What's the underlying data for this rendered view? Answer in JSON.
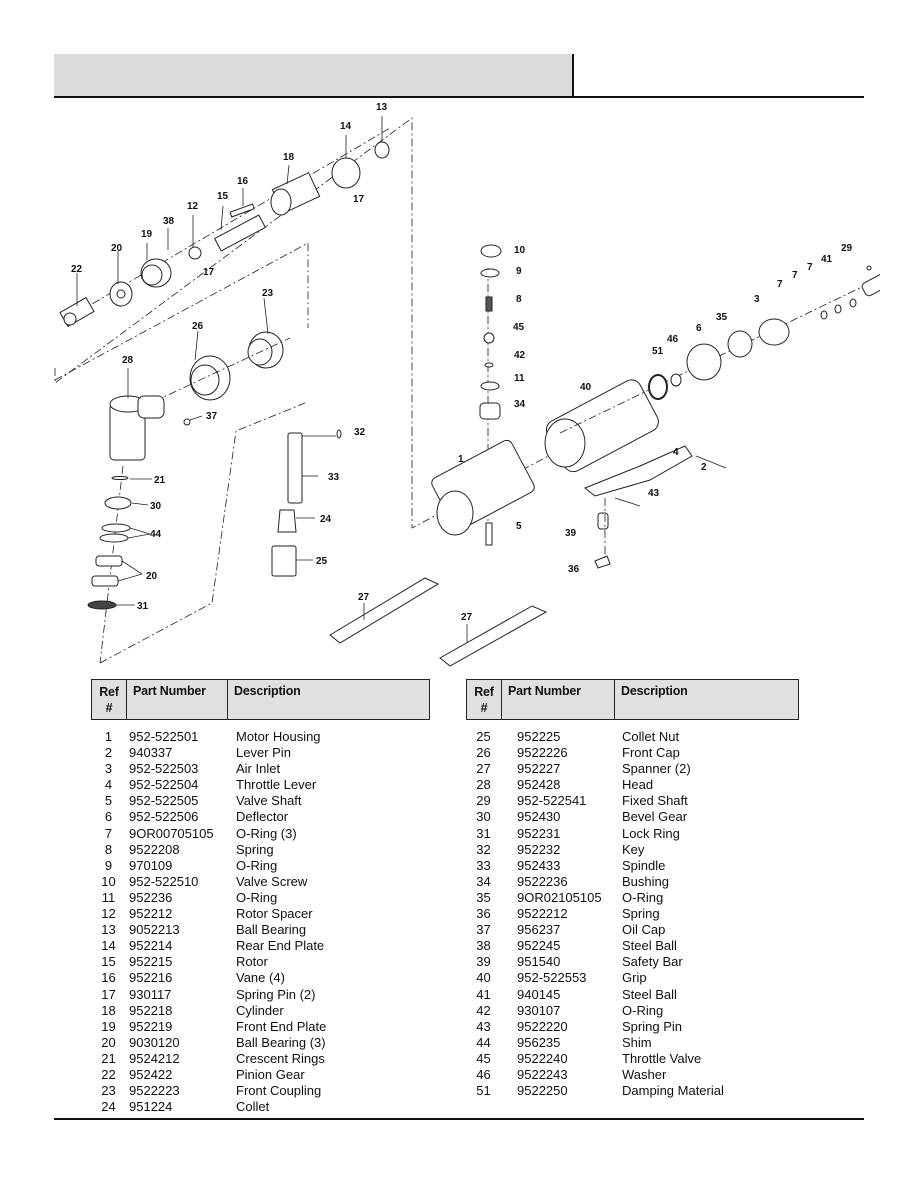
{
  "header": {
    "title": "",
    "section": ""
  },
  "diagram": {
    "labels": [
      "1",
      "2",
      "3",
      "4",
      "5",
      "6",
      "7",
      "7",
      "7",
      "8",
      "9",
      "10",
      "11",
      "12",
      "13",
      "14",
      "15",
      "16",
      "17",
      "17",
      "18",
      "19",
      "20",
      "20",
      "21",
      "22",
      "23",
      "24",
      "25",
      "26",
      "27",
      "27",
      "28",
      "29",
      "30",
      "31",
      "32",
      "33",
      "34",
      "35",
      "36",
      "37",
      "38",
      "39",
      "40",
      "41",
      "42",
      "43",
      "44",
      "45",
      "46",
      "51"
    ]
  },
  "parts_table": {
    "headers": {
      "ref": "Ref #",
      "ref_line1": "Ref",
      "ref_line2": "#",
      "part_number": "Part Number",
      "description": "Description"
    },
    "left": [
      {
        "ref": "1",
        "part_number": "952-522501",
        "description": "Motor Housing"
      },
      {
        "ref": "2",
        "part_number": "940337",
        "description": "Lever Pin"
      },
      {
        "ref": "3",
        "part_number": "952-522503",
        "description": "Air Inlet"
      },
      {
        "ref": "4",
        "part_number": "952-522504",
        "description": "Throttle Lever"
      },
      {
        "ref": "5",
        "part_number": "952-522505",
        "description": "Valve Shaft"
      },
      {
        "ref": "6",
        "part_number": "952-522506",
        "description": "Deflector"
      },
      {
        "ref": "7",
        "part_number": "9OR00705105",
        "description": "O-Ring (3)"
      },
      {
        "ref": "8",
        "part_number": "9522208",
        "description": "Spring"
      },
      {
        "ref": "9",
        "part_number": "970109",
        "description": "O-Ring"
      },
      {
        "ref": "10",
        "part_number": "952-522510",
        "description": "Valve Screw"
      },
      {
        "ref": "11",
        "part_number": "952236",
        "description": "O-Ring"
      },
      {
        "ref": "12",
        "part_number": "952212",
        "description": "Rotor Spacer"
      },
      {
        "ref": "13",
        "part_number": "9052213",
        "description": "Ball  Bearing"
      },
      {
        "ref": "14",
        "part_number": "952214",
        "description": "Rear End Plate"
      },
      {
        "ref": "15",
        "part_number": "952215",
        "description": "Rotor"
      },
      {
        "ref": "16",
        "part_number": "952216",
        "description": "Vane (4)"
      },
      {
        "ref": "17",
        "part_number": "930117",
        "description": "Spring Pin (2)"
      },
      {
        "ref": "18",
        "part_number": "952218",
        "description": "Cylinder"
      },
      {
        "ref": "19",
        "part_number": "952219",
        "description": "Front End Plate"
      },
      {
        "ref": "20",
        "part_number": "9030120",
        "description": "Ball Bearing (3)"
      },
      {
        "ref": "21",
        "part_number": "9524212",
        "description": "Crescent Rings"
      },
      {
        "ref": "22",
        "part_number": "952422",
        "description": "Pinion Gear"
      },
      {
        "ref": "23",
        "part_number": "9522223",
        "description": "Front Coupling"
      },
      {
        "ref": "24",
        "part_number": "951224",
        "description": "Collet"
      }
    ],
    "right": [
      {
        "ref": "25",
        "part_number": "952225",
        "description": "Collet Nut"
      },
      {
        "ref": "26",
        "part_number": "9522226",
        "description": "Front Cap"
      },
      {
        "ref": "27",
        "part_number": "952227",
        "description": "Spanner (2)"
      },
      {
        "ref": "28",
        "part_number": "952428",
        "description": "Head"
      },
      {
        "ref": "29",
        "part_number": "952-522541",
        "description": "Fixed Shaft"
      },
      {
        "ref": "30",
        "part_number": "952430",
        "description": "Bevel Gear"
      },
      {
        "ref": "31",
        "part_number": "952231",
        "description": "Lock Ring"
      },
      {
        "ref": "32",
        "part_number": "952232",
        "description": "Key"
      },
      {
        "ref": "33",
        "part_number": "952433",
        "description": "Spindle"
      },
      {
        "ref": "34",
        "part_number": "9522236",
        "description": "Bushing"
      },
      {
        "ref": "35",
        "part_number": "9OR02105105",
        "description": "O-Ring"
      },
      {
        "ref": "36",
        "part_number": "9522212",
        "description": "Spring"
      },
      {
        "ref": "37",
        "part_number": "956237",
        "description": "Oil Cap"
      },
      {
        "ref": "38",
        "part_number": "952245",
        "description": "Steel Ball"
      },
      {
        "ref": "39",
        "part_number": "951540",
        "description": "Safety Bar"
      },
      {
        "ref": "40",
        "part_number": "952-522553",
        "description": "Grip"
      },
      {
        "ref": "41",
        "part_number": "940145",
        "description": "Steel Ball"
      },
      {
        "ref": "42",
        "part_number": "930107",
        "description": "O-Ring"
      },
      {
        "ref": "43",
        "part_number": "9522220",
        "description": "Spring Pin"
      },
      {
        "ref": "44",
        "part_number": "956235",
        "description": "Shim"
      },
      {
        "ref": "45",
        "part_number": "9522240",
        "description": "Throttle Valve"
      },
      {
        "ref": "46",
        "part_number": "9522243",
        "description": "Washer"
      },
      {
        "ref": "51",
        "part_number": "9522250",
        "description": "Damping  Material"
      }
    ]
  }
}
